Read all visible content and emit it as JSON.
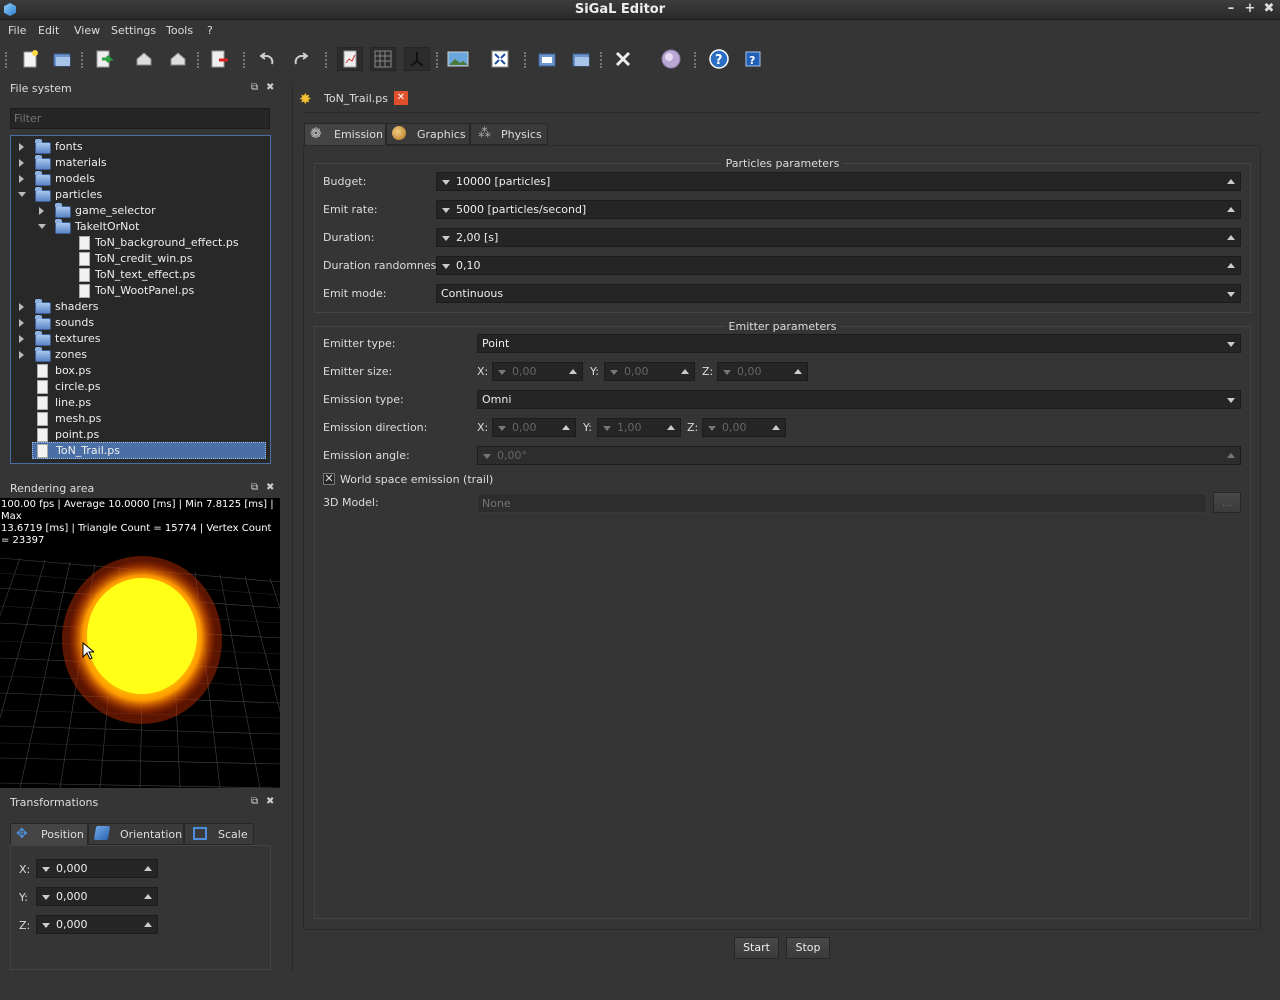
{
  "app": {
    "title": "SiGaL Editor"
  },
  "menu": [
    "File",
    "Edit",
    "View",
    "Settings",
    "Tools",
    "?"
  ],
  "filesystem": {
    "title": "File system",
    "filter_placeholder": "Filter",
    "tree": {
      "fonts": "fonts",
      "materials": "materials",
      "models": "models",
      "particles": "particles",
      "game_selector": "game_selector",
      "takeitornot": "TakeItOrNot",
      "ton_bg": "ToN_background_effect.ps",
      "ton_credit": "ToN_credit_win.ps",
      "ton_text": "ToN_text_effect.ps",
      "ton_woot": "ToN_WootPanel.ps",
      "shaders": "shaders",
      "sounds": "sounds",
      "textures": "textures",
      "zones": "zones",
      "box": "box.ps",
      "circle": "circle.ps",
      "line": "line.ps",
      "mesh": "mesh.ps",
      "point": "point.ps",
      "ton_trail": "ToN_Trail.ps"
    }
  },
  "rendering": {
    "title": "Rendering area",
    "stats_line1": "100.00 fps |  Average 10.0000 [ms]  | Min 7.8125 [ms]  | Max",
    "stats_line2": "13.6719 [ms] | Triangle Count = 15774 | Vertex Count = 23397"
  },
  "transformations": {
    "title": "Transformations",
    "tabs": [
      "Position",
      "Orientation",
      "Scale"
    ],
    "x_label": "X:",
    "y_label": "Y:",
    "z_label": "Z:",
    "x": "0,000",
    "y": "0,000",
    "z": "0,000"
  },
  "document_tab": {
    "label": "ToN_Trail.ps"
  },
  "sub_tabs": [
    "Emission",
    "Graphics",
    "Physics"
  ],
  "particles_params": {
    "title": "Particles parameters",
    "budget_label": "Budget:",
    "budget": "10000 [particles]",
    "emit_rate_label": "Emit rate:",
    "emit_rate": "5000 [particles/second]",
    "duration_label": "Duration:",
    "duration": "2,00 [s]",
    "duration_rand_label": "Duration randomness:",
    "duration_rand": "0,10",
    "emit_mode_label": "Emit mode:",
    "emit_mode": "Continuous"
  },
  "emitter_params": {
    "title": "Emitter parameters",
    "emitter_type_label": "Emitter type:",
    "emitter_type": "Point",
    "emitter_size_label": "Emitter size:",
    "size_x": "0,00",
    "size_y": "0,00",
    "size_z": "0,00",
    "emission_type_label": "Emission type:",
    "emission_type": "Omni",
    "emission_dir_label": "Emission direction:",
    "dir_x": "0,00",
    "dir_y": "1,00",
    "dir_z": "0,00",
    "emission_angle_label": "Emission angle:",
    "emission_angle": "0,00°",
    "world_space_label": "World space emission (trail)",
    "world_space_checked": true,
    "model_label": "3D Model:",
    "model_placeholder": "None",
    "browse_label": "..."
  },
  "axis_labels": {
    "x": "X:",
    "y": "Y:",
    "z": "Z:"
  },
  "actions": {
    "start": "Start",
    "stop": "Stop"
  },
  "colors": {
    "selection": "#4a6fa5",
    "accent_close": "#e0502d"
  }
}
